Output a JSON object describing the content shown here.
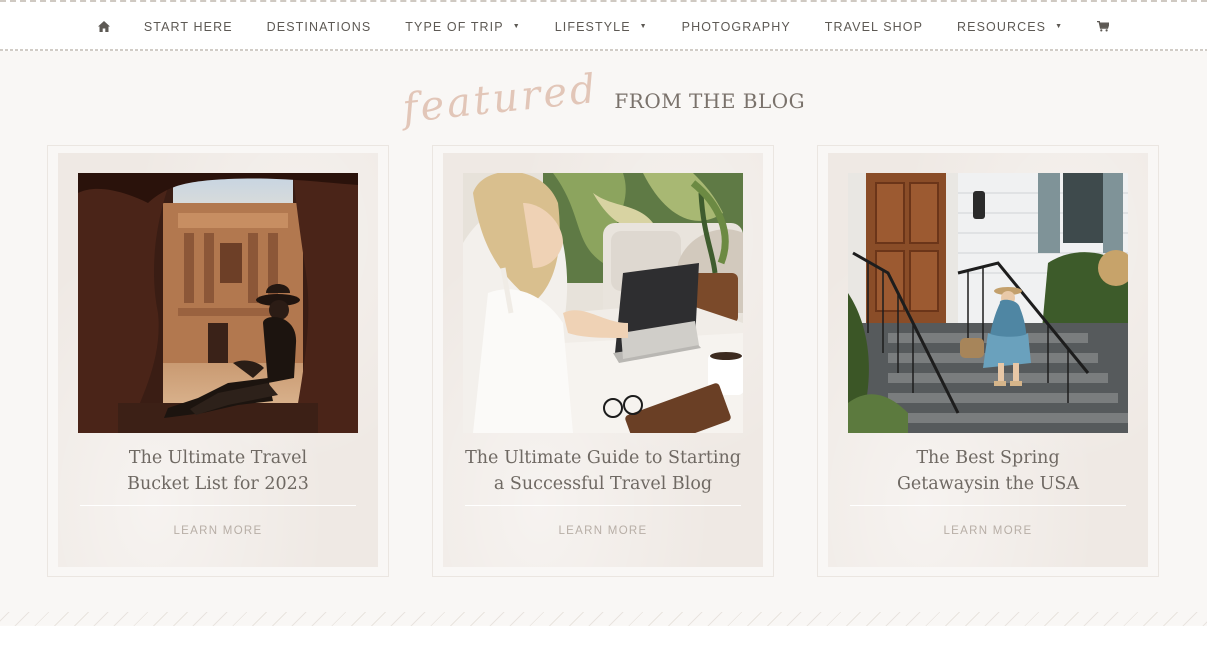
{
  "nav": {
    "home_icon": "home-icon",
    "items": [
      {
        "label": "START HERE",
        "dropdown": false
      },
      {
        "label": "DESTINATIONS",
        "dropdown": false
      },
      {
        "label": "TYPE OF TRIP",
        "dropdown": true
      },
      {
        "label": "LIFESTYLE",
        "dropdown": true
      },
      {
        "label": "PHOTOGRAPHY",
        "dropdown": false
      },
      {
        "label": "TRAVEL SHOP",
        "dropdown": false
      },
      {
        "label": "RESOURCES",
        "dropdown": true
      }
    ],
    "cart_icon": "cart-icon",
    "caret": "▼"
  },
  "section": {
    "script_word": "featured",
    "heading": "FROM THE BLOG"
  },
  "cards": [
    {
      "title_line1": "The Ultimate Travel",
      "title_line2": "Bucket List for 2023",
      "cta": "LEARN MORE",
      "photo": "petra-monastery-photo"
    },
    {
      "title_line1": "The Ultimate Guide to Starting",
      "title_line2": "a Successful Travel Blog",
      "cta": "LEARN MORE",
      "photo": "woman-laptop-photo"
    },
    {
      "title_line1": "The Best Spring",
      "title_line2": "Getawaysin the USA",
      "cta": "LEARN MORE",
      "photo": "woman-porch-steps-photo"
    }
  ],
  "colors": {
    "background": "#f9f7f5",
    "card": "#efe9e4",
    "accent_script": "#e2c6b8",
    "text": "#6f6963"
  }
}
